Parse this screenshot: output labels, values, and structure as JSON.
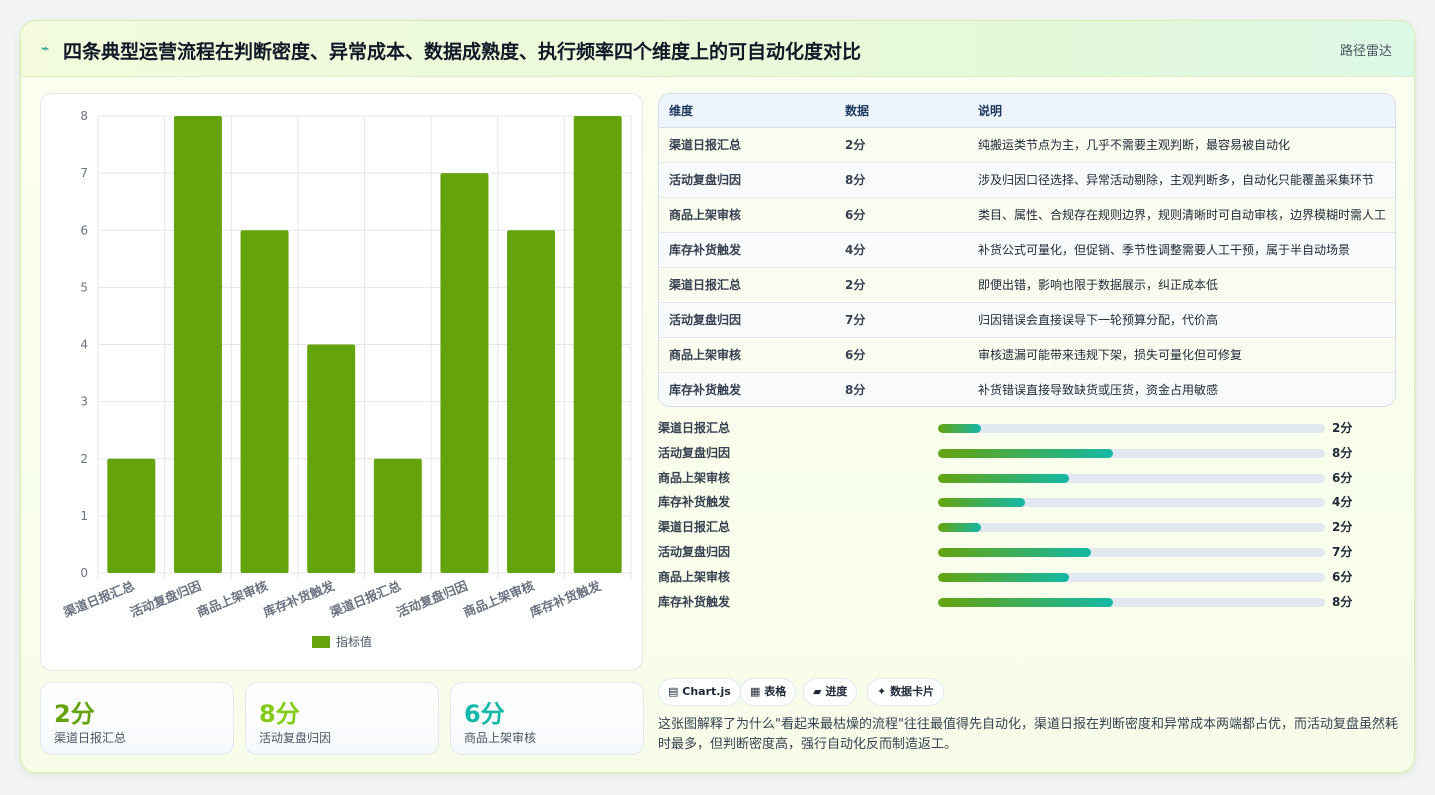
{
  "header": {
    "icon": "lightning-icon",
    "title": "四条典型运营流程在判断密度、异常成本、数据成熟度、执行频率四个维度上的可自动化度对比",
    "subtitle": "路径雷达"
  },
  "chart_data": {
    "type": "bar",
    "categories": [
      "渠道日报汇总",
      "活动复盘归因",
      "商品上架审核",
      "库存补货触发",
      "渠道日报汇总",
      "活动复盘归因",
      "商品上架审核",
      "库存补货触发"
    ],
    "series": [
      {
        "name": "指标值",
        "values": [
          2,
          8,
          6,
          4,
          2,
          7,
          6,
          8
        ],
        "color": "#65a30d"
      }
    ],
    "ylim": [
      0,
      8
    ],
    "yticks": [
      "0",
      "1",
      "2",
      "3",
      "4",
      "5",
      "6",
      "7",
      "8"
    ],
    "grid": true,
    "legend": "bottom"
  },
  "kpis": [
    {
      "value": "2分",
      "label": "渠道日报汇总",
      "color": "#65a30d"
    },
    {
      "value": "8分",
      "label": "活动复盘归因",
      "color": "#84cc16"
    },
    {
      "value": "6分",
      "label": "商品上架审核",
      "color": "#14b8a6"
    }
  ],
  "table": {
    "headers": [
      "维度",
      "数据",
      "说明"
    ],
    "rows": [
      [
        "渠道日报汇总",
        "2分",
        "纯搬运类节点为主，几乎不需要主观判断，最容易被自动化"
      ],
      [
        "活动复盘归因",
        "8分",
        "涉及归因口径选择、异常活动剔除，主观判断多，自动化只能覆盖采集环节"
      ],
      [
        "商品上架审核",
        "6分",
        "类目、属性、合规存在规则边界，规则清晰时可自动审核，边界模糊时需人工"
      ],
      [
        "库存补货触发",
        "4分",
        "补货公式可量化，但促销、季节性调整需要人工干预，属于半自动场景"
      ],
      [
        "渠道日报汇总",
        "2分",
        "即便出错，影响也限于数据展示，纠正成本低"
      ],
      [
        "活动复盘归因",
        "7分",
        "归因错误会直接误导下一轮预算分配，代价高"
      ],
      [
        "商品上架审核",
        "6分",
        "审核遗漏可能带来违规下架，损失可量化但可修复"
      ],
      [
        "库存补货触发",
        "8分",
        "补货错误直接导致缺货或压货，资金占用敏感"
      ]
    ]
  },
  "progress": [
    {
      "label": "渠道日报汇总",
      "value": "2分",
      "fraction": 0.111
    },
    {
      "label": "活动复盘归因",
      "value": "8分",
      "fraction": 0.453
    },
    {
      "label": "商品上架审核",
      "value": "6分",
      "fraction": 0.339
    },
    {
      "label": "库存补货触发",
      "value": "4分",
      "fraction": 0.225
    },
    {
      "label": "渠道日报汇总",
      "value": "2分",
      "fraction": 0.111
    },
    {
      "label": "活动复盘归因",
      "value": "7分",
      "fraction": 0.395
    },
    {
      "label": "商品上架审核",
      "value": "6分",
      "fraction": 0.339
    },
    {
      "label": "库存补货触发",
      "value": "8分",
      "fraction": 0.453
    }
  ],
  "chips": [
    {
      "icon": "chart-icon",
      "label": "Chart.js"
    },
    {
      "icon": "table-icon",
      "label": "表格"
    },
    {
      "icon": "progress-icon",
      "label": "进度"
    },
    {
      "icon": "sparkle-icon",
      "label": "数据卡片"
    }
  ],
  "description": "这张图解释了为什么\"看起来最枯燥的流程\"往往最值得先自动化，渠道日报在判断密度和异常成本两端都占优，而活动复盘虽然耗时最多，但判断密度高，强行自动化反而制造返工。"
}
